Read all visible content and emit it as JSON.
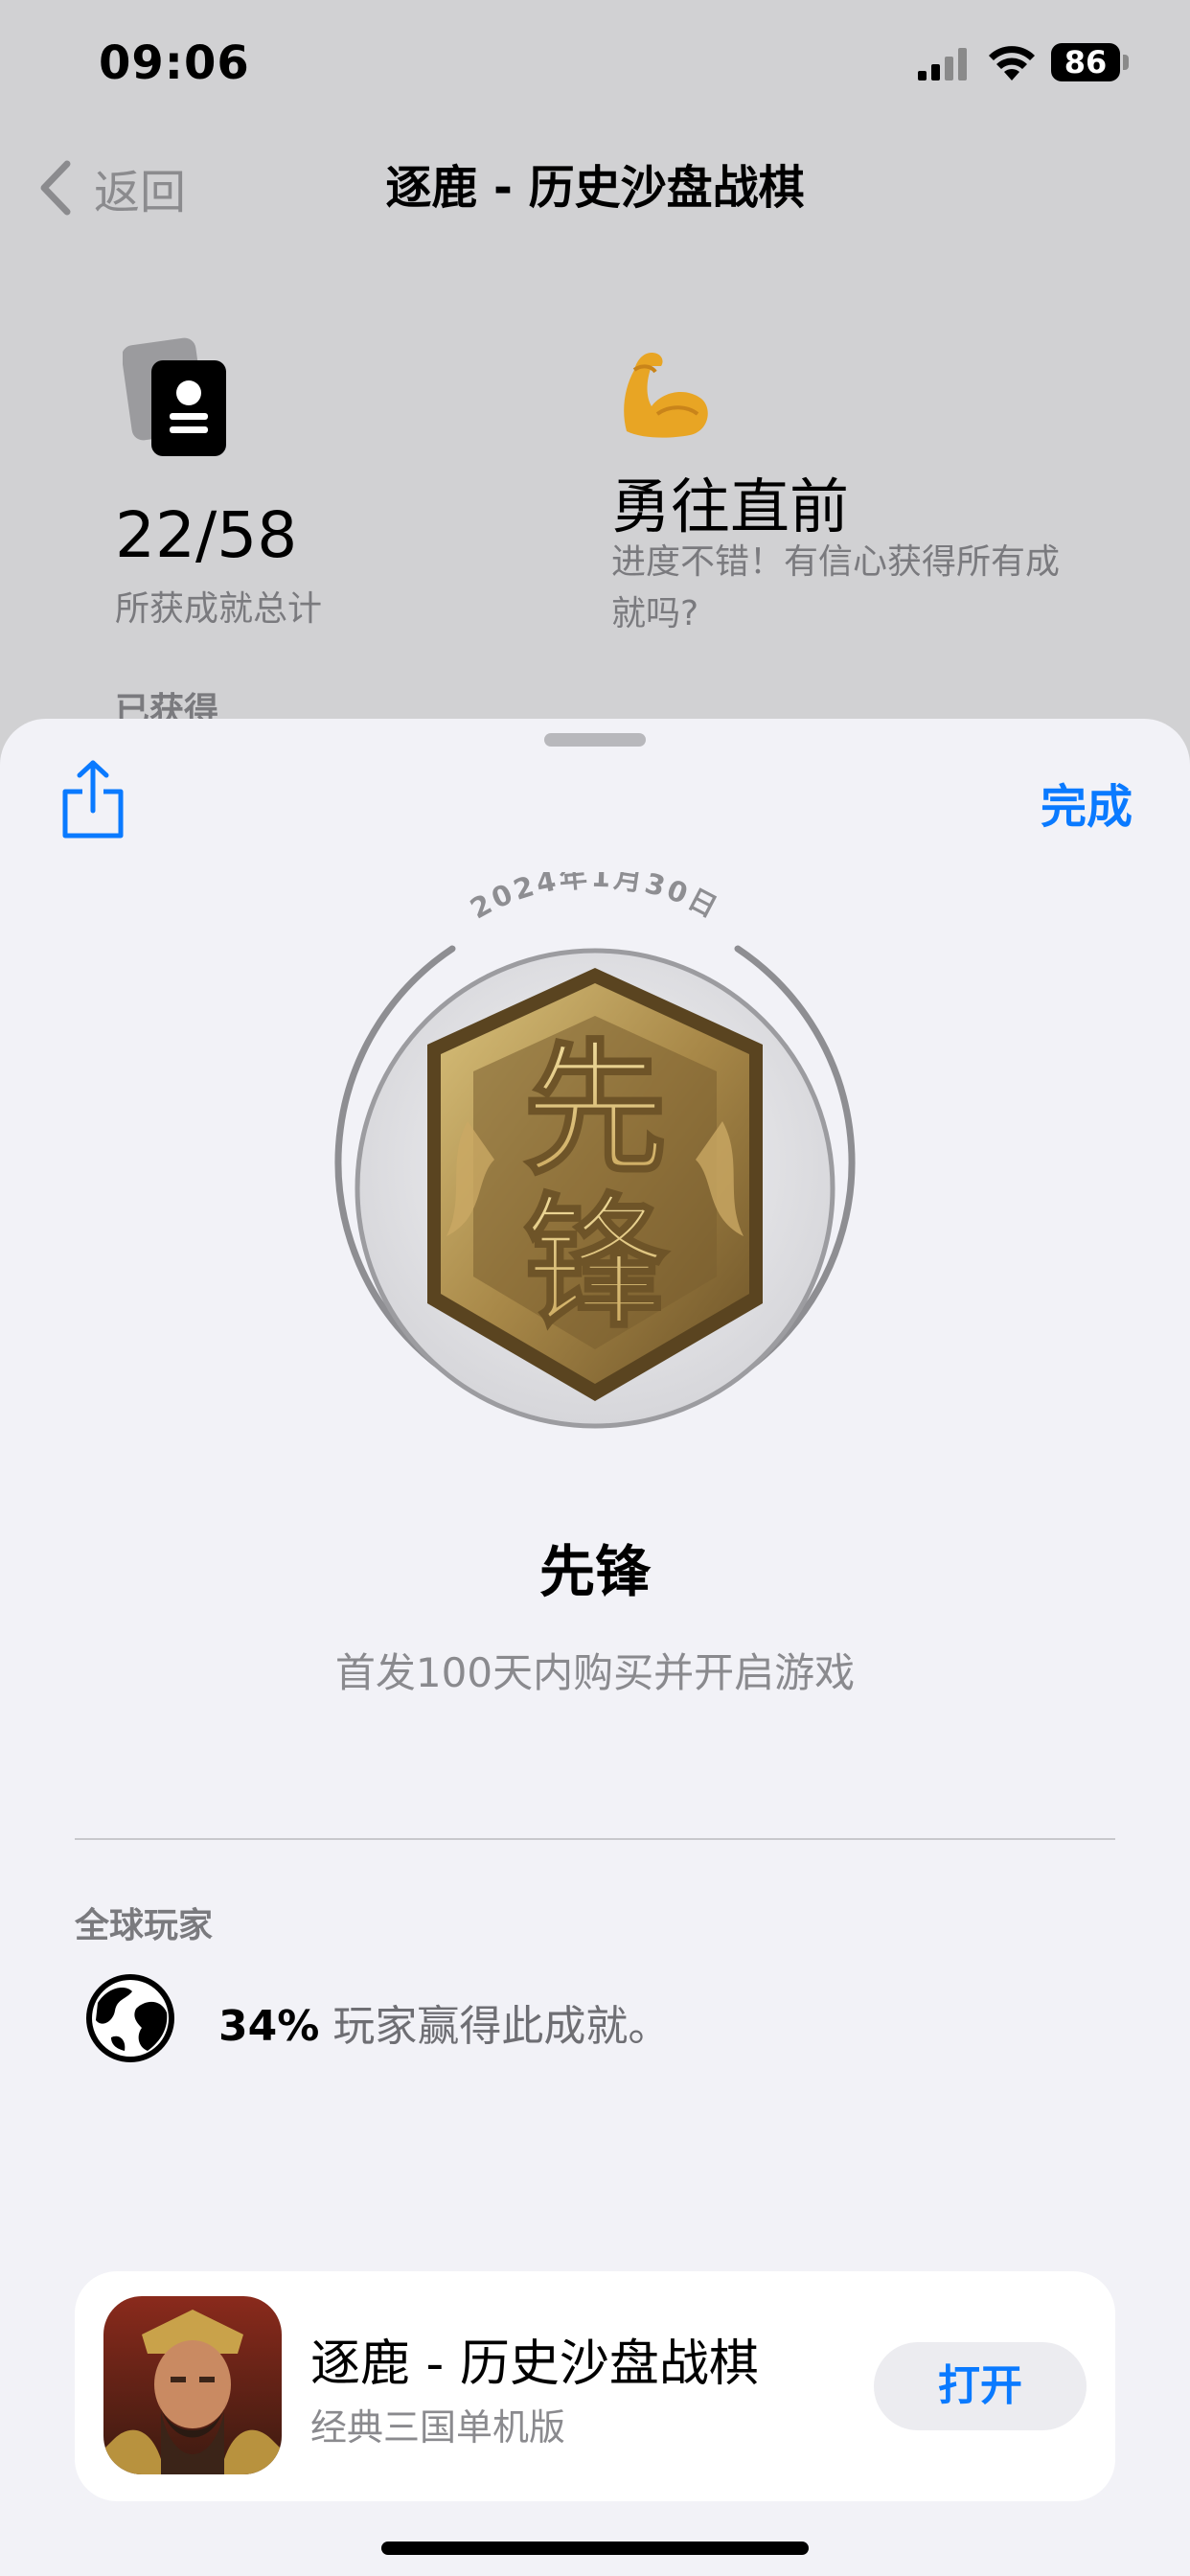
{
  "status_bar": {
    "time": "09:06",
    "battery": "86",
    "icons": [
      "signal-icon",
      "wifi-icon",
      "battery-icon"
    ]
  },
  "nav": {
    "back_label": "返回",
    "title": "逐鹿 - 历史沙盘战棋"
  },
  "summary": {
    "count": "22/58",
    "count_label": "所获成就总计",
    "rank_title": "勇往直前",
    "rank_desc": "进度不错！有信心获得所有成就吗?",
    "earned_header": "已获得"
  },
  "sheet": {
    "done_label": "完成",
    "badge": {
      "date": "2024年1月30日",
      "characters": [
        "先",
        "锋"
      ]
    },
    "achievement": {
      "title": "先锋",
      "description": "首发100天内购买并开启游戏"
    },
    "global": {
      "section_label": "全球玩家",
      "percent": "34%",
      "text": "玩家赢得此成就。"
    },
    "app_card": {
      "name": "逐鹿 - 历史沙盘战棋",
      "subtitle": "经典三国单机版",
      "open_label": "打开"
    }
  },
  "colors": {
    "accent": "#0a7aff",
    "sheet_bg": "#f2f2f7",
    "dim_bg": "#d1d1d3",
    "badge_gold": "#b89a56"
  }
}
